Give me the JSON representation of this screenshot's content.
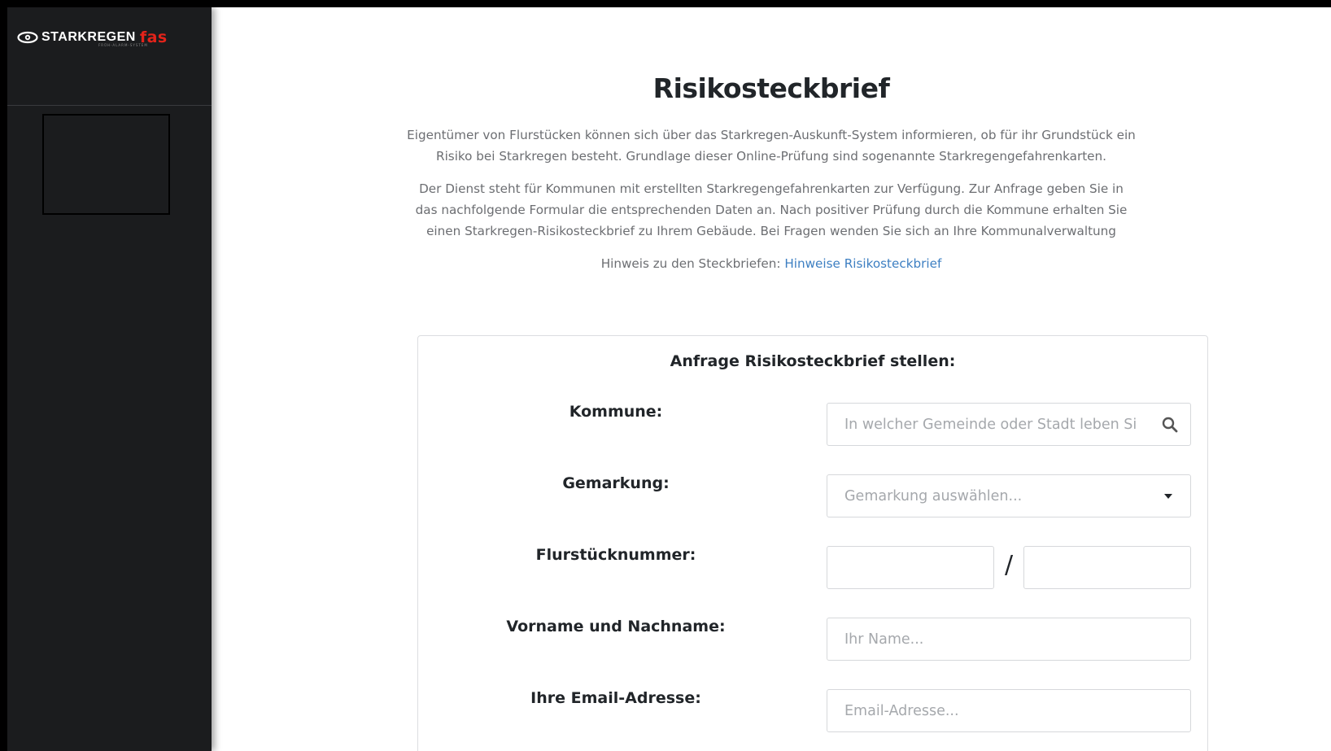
{
  "sidebar": {
    "logo_text": "STARKREGEN",
    "logo_accent": "fas",
    "logo_subtitle": "FRÜH-ALARM-SYSTEM",
    "logo_icon": "eye-icon",
    "accent_color": "#e2231a",
    "background_color": "#1b1c1e"
  },
  "page": {
    "title": "Risikosteckbrief",
    "intro_1": "Eigentümer von Flurstücken können sich über das Starkregen-Auskunft-System informieren, ob für ihr Grundstück ein Risiko bei Starkregen besteht. Grundlage dieser Online-Prüfung sind sogenannte Starkregengefahrenkarten.",
    "intro_2": "Der Dienst steht für Kommunen mit erstellten Starkregengefahrenkarten zur Verfügung. Zur Anfrage geben Sie in das nachfolgende Formular die entsprechenden Daten an. Nach positiver Prüfung durch die Kommune erhalten Sie einen Starkregen-Risikosteckbrief zu Ihrem Gebäude. Bei Fragen wenden Sie sich an Ihre Kommunalverwaltung",
    "hint_prefix": "Hinweis zu den Steckbriefen: ",
    "hint_link": "Hinweise Risikosteckbrief",
    "link_color": "#3d7fc2"
  },
  "form": {
    "title": "Anfrage Risikosteckbrief stellen:",
    "kommune_label": "Kommune:",
    "kommune_placeholder": "In welcher Gemeinde oder Stadt leben Si",
    "gemarkung_label": "Gemarkung:",
    "gemarkung_placeholder": "Gemarkung auswählen...",
    "flurstueck_label": "Flurstücknummer:",
    "flurstueck_separator": "/",
    "name_label": "Vorname und Nachname:",
    "name_placeholder": "Ihr Name...",
    "email_label": "Ihre Email-Adresse:",
    "email_placeholder": "Email-Adresse..."
  }
}
